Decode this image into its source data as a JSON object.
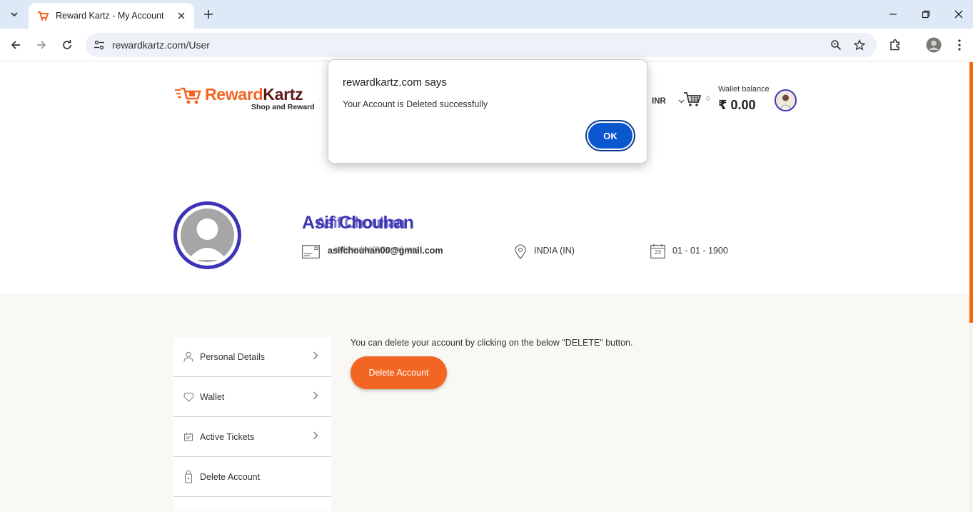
{
  "browser": {
    "tab_title": "Reward Kartz - My Account",
    "url": "rewardkartz.com/User"
  },
  "header": {
    "logo_primary": "Reward",
    "logo_secondary": "Kartz",
    "logo_tagline": "Shop and Reward",
    "currency": "INR",
    "cart_count": "0",
    "wallet_label": "Wallet balance",
    "wallet_amount": "₹ 0.00"
  },
  "profile": {
    "name": "Asif Chouhan",
    "email": "asifchouhan00@gmail.com",
    "country": "INDIA (IN)",
    "dob": "01 - 01 - 1900",
    "calendar_day": "23"
  },
  "menu": {
    "items": [
      {
        "label": "Personal Details",
        "icon": "person-icon"
      },
      {
        "label": "Wallet",
        "icon": "heart-icon"
      },
      {
        "label": "Active Tickets",
        "icon": "ticket-icon"
      },
      {
        "label": "Delete Account",
        "icon": "lock-icon"
      }
    ]
  },
  "content": {
    "delete_note": "You can delete your account by clicking on the below \"DELETE\" button.",
    "delete_button": "Delete Account"
  },
  "dialog": {
    "title": "rewardkartz.com says",
    "message": "Your Account is Deleted successfully",
    "ok_label": "OK"
  },
  "colors": {
    "brand_orange": "#f26522",
    "brand_purple": "#3d35b5",
    "dialog_button": "#0b57d0"
  }
}
